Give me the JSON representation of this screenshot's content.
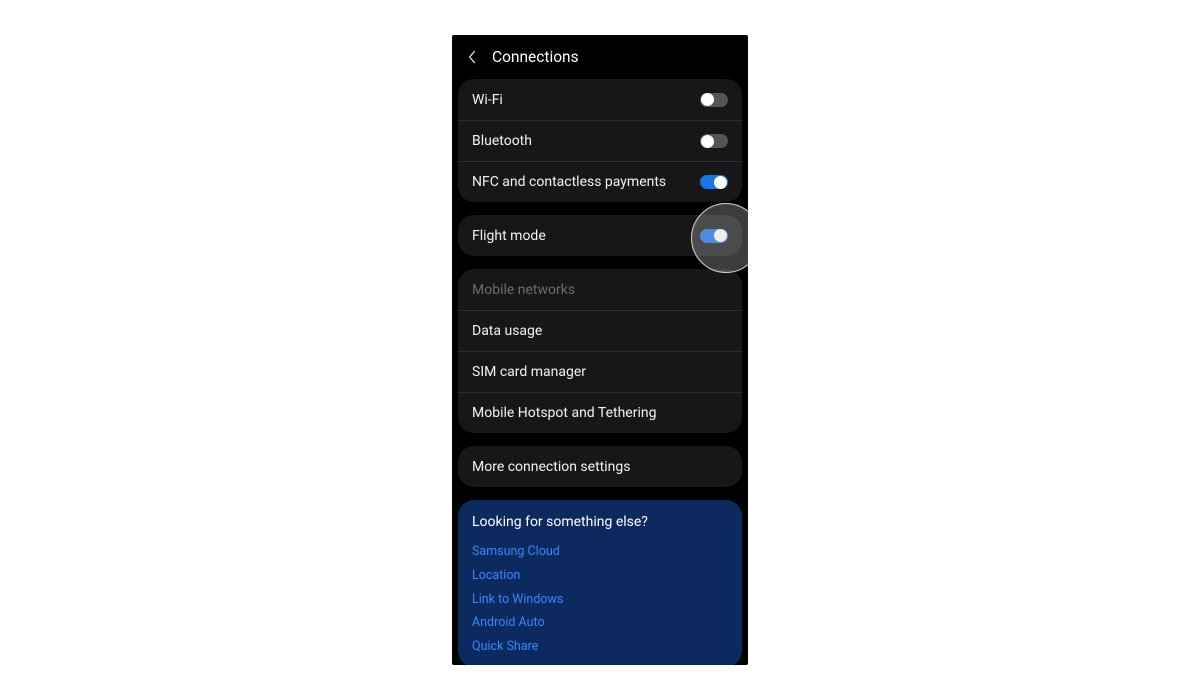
{
  "header": {
    "title": "Connections"
  },
  "groups": [
    {
      "id": "g1",
      "rows": [
        {
          "id": "wifi",
          "label": "Wi-Fi",
          "toggle": "off"
        },
        {
          "id": "bluetooth",
          "label": "Bluetooth",
          "toggle": "off"
        },
        {
          "id": "nfc",
          "label": "NFC and contactless payments",
          "toggle": "on"
        }
      ]
    },
    {
      "id": "g2",
      "rows": [
        {
          "id": "flight",
          "label": "Flight mode",
          "toggle": "on",
          "highlighted": true
        }
      ]
    },
    {
      "id": "g3",
      "rows": [
        {
          "id": "mobile-networks",
          "label": "Mobile networks",
          "disabled": true
        },
        {
          "id": "data-usage",
          "label": "Data usage"
        },
        {
          "id": "sim",
          "label": "SIM card manager"
        },
        {
          "id": "hotspot",
          "label": "Mobile Hotspot and Tethering"
        }
      ]
    },
    {
      "id": "g4",
      "rows": [
        {
          "id": "more",
          "label": "More connection settings"
        }
      ]
    }
  ],
  "help": {
    "title": "Looking for something else?",
    "links": [
      "Samsung Cloud",
      "Location",
      "Link to Windows",
      "Android Auto",
      "Quick Share"
    ]
  },
  "colors": {
    "accent": "#1a73e8",
    "help_bg": "#0c2a5e",
    "link": "#3a86ff"
  }
}
